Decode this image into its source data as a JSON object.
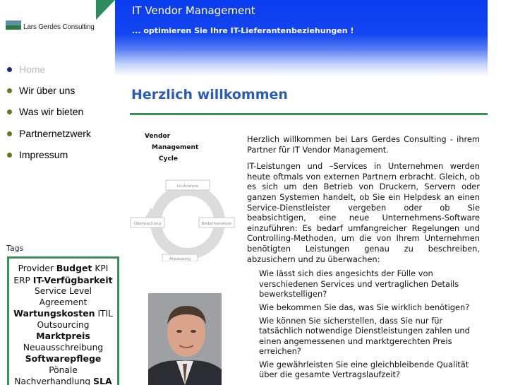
{
  "logo": {
    "name": "Lars Gerdes Consulting"
  },
  "header": {
    "title": "IT Vendor Management",
    "subtitle": "... optimieren Sie Ihre IT-Lieferantenbeziehungen !"
  },
  "nav": {
    "items": [
      {
        "label": "Home"
      },
      {
        "label": "Wir über uns"
      },
      {
        "label": "Was wir bieten"
      },
      {
        "label": "Partnernetzwerk"
      },
      {
        "label": "Impressum"
      }
    ]
  },
  "tags": {
    "title": "Tags",
    "items": [
      {
        "text": "Provider",
        "bold": false
      },
      {
        "text": "Budget",
        "bold": true
      },
      {
        "text": "KPI",
        "bold": false
      },
      {
        "text": "ERP",
        "bold": false
      },
      {
        "text": "IT-Verfügbarkeit",
        "bold": true
      },
      {
        "text": "Service Level Agreement",
        "bold": false
      },
      {
        "text": "Wartungskosten",
        "bold": true
      },
      {
        "text": "ITIL",
        "bold": false
      },
      {
        "text": "Outsourcing",
        "bold": false
      },
      {
        "text": "Marktpreis",
        "bold": true
      },
      {
        "text": "Neuausschreibung",
        "bold": false
      },
      {
        "text": "Softwarepflege",
        "bold": true
      },
      {
        "text": "Pönale",
        "bold": false
      },
      {
        "text": "Nachverhandlung",
        "bold": false
      },
      {
        "text": "SLA",
        "bold": true
      }
    ]
  },
  "main": {
    "heading": "Herzlich willkommen",
    "intro": "Herzlich willkommen bei Lars Gerdes Consulting  -  ihrem Partner für IT Vendor Management.",
    "body": "IT-Leistungen und –Services in Unternehmen werden heute oftmals von externen Partnern erbracht. Gleich, ob es sich um den Betrieb von Druckern,  Servern oder ganzen Systemen handelt, ob Sie ein Helpdesk an einen Service-Dienstleister vergeben oder ob Sie beabsichtigen, eine neue Unternehmens-Software einzuführen: Es bedarf umfangreicher Regelungen und Controlling-Methoden, um die von Ihrem Unternehmen benötigten Leistungen genau zu beschreiben, abzusichern und zu überwachen:",
    "questions": [
      "Wie lässt sich dies angesichts der Fülle von verschiedenen Services und vertraglichen Details bewerkstelligen?",
      "Wie bekommen Sie das, was Sie wirklich benötigen?",
      "Wie können Sie sicherstellen, dass Sie nur für tatsächlich notwendige Dienstleistungen zahlen und einen angemessenen und marktgerechten Preis erreichen?",
      "Wie gewährleisten Sie eine gleichbleibende Qualität über die gesamte Vertragslaufzeit?"
    ]
  },
  "diagram": {
    "title_lines": [
      "Vendor",
      "Management",
      "Cycle"
    ],
    "stages": [
      "Ist-Analyse",
      "Bedarfsanalyse",
      "Anpassung",
      "Überwachung"
    ]
  },
  "colors": {
    "banner_blue": "#0a3cf0",
    "accent_green": "#3d8f5a",
    "heading_blue": "#2a5db0",
    "nav_bullet": "#5f7a1c"
  }
}
